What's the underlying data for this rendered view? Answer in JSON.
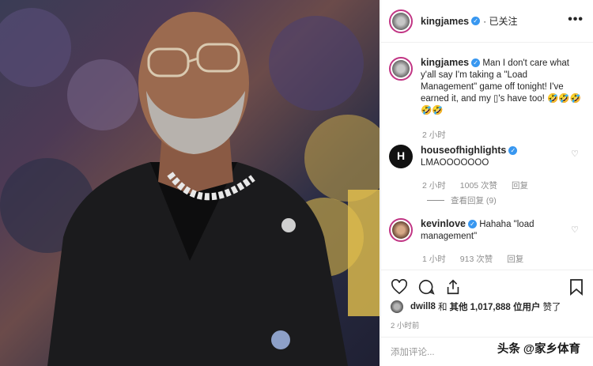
{
  "post": {
    "username": "kingjames",
    "follow_status": "· 已关注",
    "more_icon": "more-icon",
    "caption": "Man I don't care what y'all say I'm taking a \"Load Management\" game off tonight! I've earned it, and my ▯'s have too! 🤣🤣🤣🤣🤣",
    "caption_time": "2 小时"
  },
  "comments": [
    {
      "username": "houseofhighlights",
      "text": "LMAOOOOOOO",
      "time": "2 小时",
      "likes": "1005 次赞",
      "reply": "回复",
      "view_replies": "查看回复 (9)"
    },
    {
      "username": "kevinlove",
      "text": "Hahaha \"load management\"",
      "time": "1 小时",
      "likes": "913 次赞",
      "reply": "回复"
    }
  ],
  "likes_line": {
    "first_user": "dwill8",
    "connector": "和",
    "others": "其他 1,017,888 位用户",
    "suffix": "赞了"
  },
  "post_time": "2 小时前",
  "add_comment_placeholder": "添加评论...",
  "watermark": "头条 @家乡体育",
  "colors": {
    "verified": "#3897f0",
    "story_ring": "#c13584",
    "text": "#262626",
    "muted": "#8e8e8e"
  }
}
